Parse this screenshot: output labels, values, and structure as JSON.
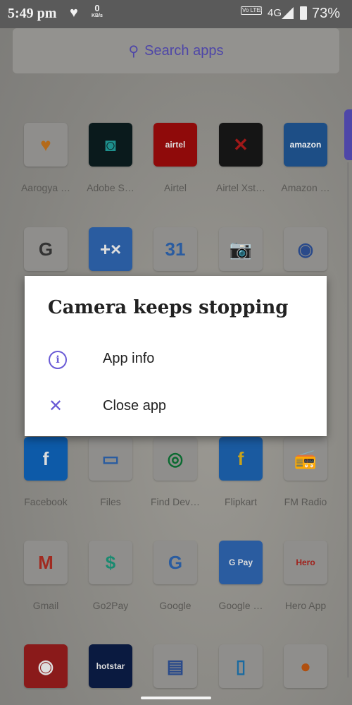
{
  "status": {
    "time": "5:49 pm",
    "speed": "0",
    "speed_unit": "KB/s",
    "volte": "Vo LTE",
    "network": "4G",
    "battery": "73%"
  },
  "search": {
    "placeholder": "Search apps"
  },
  "colors": {
    "accent": "#6a5bd6",
    "scroll_thumb": "#4e46a8"
  },
  "apps": [
    [
      {
        "label": "Aarogya …",
        "icon": "aarogya-setu-icon",
        "color": "#8f8e8c",
        "glyph": "♥",
        "fg": "#b46a1a"
      },
      {
        "label": "Adobe S…",
        "icon": "adobe-scan-icon",
        "color": "#0a1a1c",
        "glyph": "◙",
        "fg": "#1e8f8c"
      },
      {
        "label": "Airtel",
        "icon": "airtel-icon",
        "color": "#8f0a0a",
        "glyph": "airtel",
        "fg": "#ddd"
      },
      {
        "label": "Airtel Xst…",
        "icon": "airtel-xstream-icon",
        "color": "#151515",
        "glyph": "✕",
        "fg": "#a01818"
      },
      {
        "label": "Amazon …",
        "icon": "amazon-icon",
        "color": "#1d4e86",
        "glyph": "amazon",
        "fg": "#eee"
      }
    ],
    [
      {
        "label": "",
        "icon": "authenticator-icon",
        "color": "#8f8e8c",
        "glyph": "G",
        "fg": "#333"
      },
      {
        "label": "",
        "icon": "calculator-icon",
        "color": "#2a5ca0",
        "glyph": "+×",
        "fg": "#ddd"
      },
      {
        "label": "",
        "icon": "calendar-icon",
        "color": "#8f8e8c",
        "glyph": "31",
        "fg": "#2a5ca0"
      },
      {
        "label": "",
        "icon": "camera-icon",
        "color": "#8f8e8c",
        "glyph": "📷",
        "fg": "#222"
      },
      {
        "label": "",
        "icon": "camera-app-icon",
        "color": "#8f8e8c",
        "glyph": "◉",
        "fg": "#2a4a8a"
      }
    ],
    [
      {
        "label": "Facebook",
        "icon": "facebook-icon",
        "color": "#0d5aa8",
        "glyph": "f",
        "fg": "#ddd"
      },
      {
        "label": "Files",
        "icon": "files-icon",
        "color": "#8f8e8c",
        "glyph": "▭",
        "fg": "#2a5ca0"
      },
      {
        "label": "Find Dev…",
        "icon": "find-device-icon",
        "color": "#8f8e8c",
        "glyph": "◎",
        "fg": "#0a6a30"
      },
      {
        "label": "Flipkart",
        "icon": "flipkart-icon",
        "color": "#1a5aa0",
        "glyph": "f",
        "fg": "#c8a21a"
      },
      {
        "label": "FM Radio",
        "icon": "fm-radio-icon",
        "color": "#8f8e8c",
        "glyph": "📻",
        "fg": "#5a3aa0"
      }
    ],
    [
      {
        "label": "Gmail",
        "icon": "gmail-icon",
        "color": "#8f8e8c",
        "glyph": "M",
        "fg": "#a02a20"
      },
      {
        "label": "Go2Pay",
        "icon": "go2pay-icon",
        "color": "#8f8e8c",
        "glyph": "$",
        "fg": "#1a8a70"
      },
      {
        "label": "Google",
        "icon": "google-icon",
        "color": "#8f8e8c",
        "glyph": "G",
        "fg": "#2a5ca0"
      },
      {
        "label": "Google …",
        "icon": "google-pay-icon",
        "color": "#2a5ca0",
        "glyph": "G Pay",
        "fg": "#ddd"
      },
      {
        "label": "Hero App",
        "icon": "hero-icon",
        "color": "#8f8e8c",
        "glyph": "Hero",
        "fg": "#a0201a"
      }
    ],
    [
      {
        "label": "",
        "icon": "record-app-icon",
        "color": "#8a1a1a",
        "glyph": "◉",
        "fg": "#ddd"
      },
      {
        "label": "",
        "icon": "hotstar-icon",
        "color": "#0a1a40",
        "glyph": "hotstar",
        "fg": "#ddd"
      },
      {
        "label": "",
        "icon": "ignou-icon",
        "color": "#8f8e8c",
        "glyph": "▤",
        "fg": "#2a4a8a"
      },
      {
        "label": "",
        "icon": "phone-app-icon",
        "color": "#8f8e8c",
        "glyph": "▯",
        "fg": "#1a6aa0"
      },
      {
        "label": "",
        "icon": "indian-oil-icon",
        "color": "#8f8e8c",
        "glyph": "●",
        "fg": "#b05010"
      }
    ]
  ],
  "dialog": {
    "title": "Camera keeps stopping",
    "items": [
      {
        "label": "App info",
        "icon": "info-icon"
      },
      {
        "label": "Close app",
        "icon": "close-icon"
      }
    ]
  }
}
